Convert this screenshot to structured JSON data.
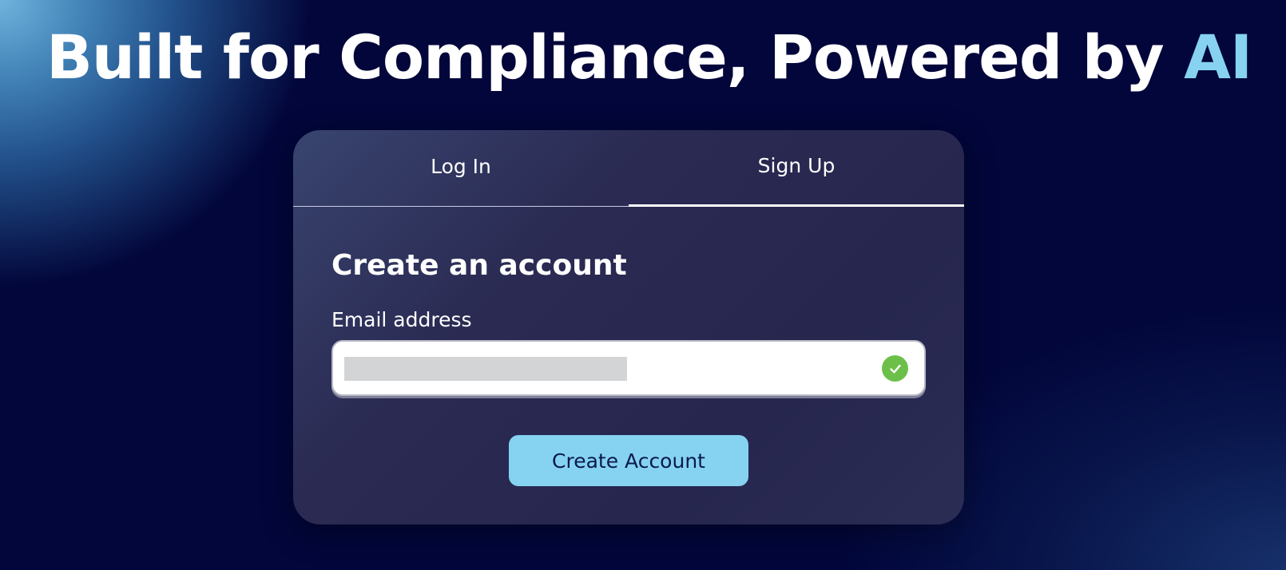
{
  "hero": {
    "title_main": "Built for Compliance, Powered by",
    "title_accent": "AI",
    "accent_color": "#86d2f0"
  },
  "auth": {
    "tabs": [
      {
        "label": "Log In",
        "active": false
      },
      {
        "label": "Sign Up",
        "active": true
      }
    ],
    "form_title": "Create an account",
    "email_label": "Email address",
    "email_value": "",
    "email_valid_icon": "check-circle-icon",
    "submit_label": "Create Account",
    "submit_color": "#85d3f1",
    "valid_color": "#6cc04a"
  }
}
